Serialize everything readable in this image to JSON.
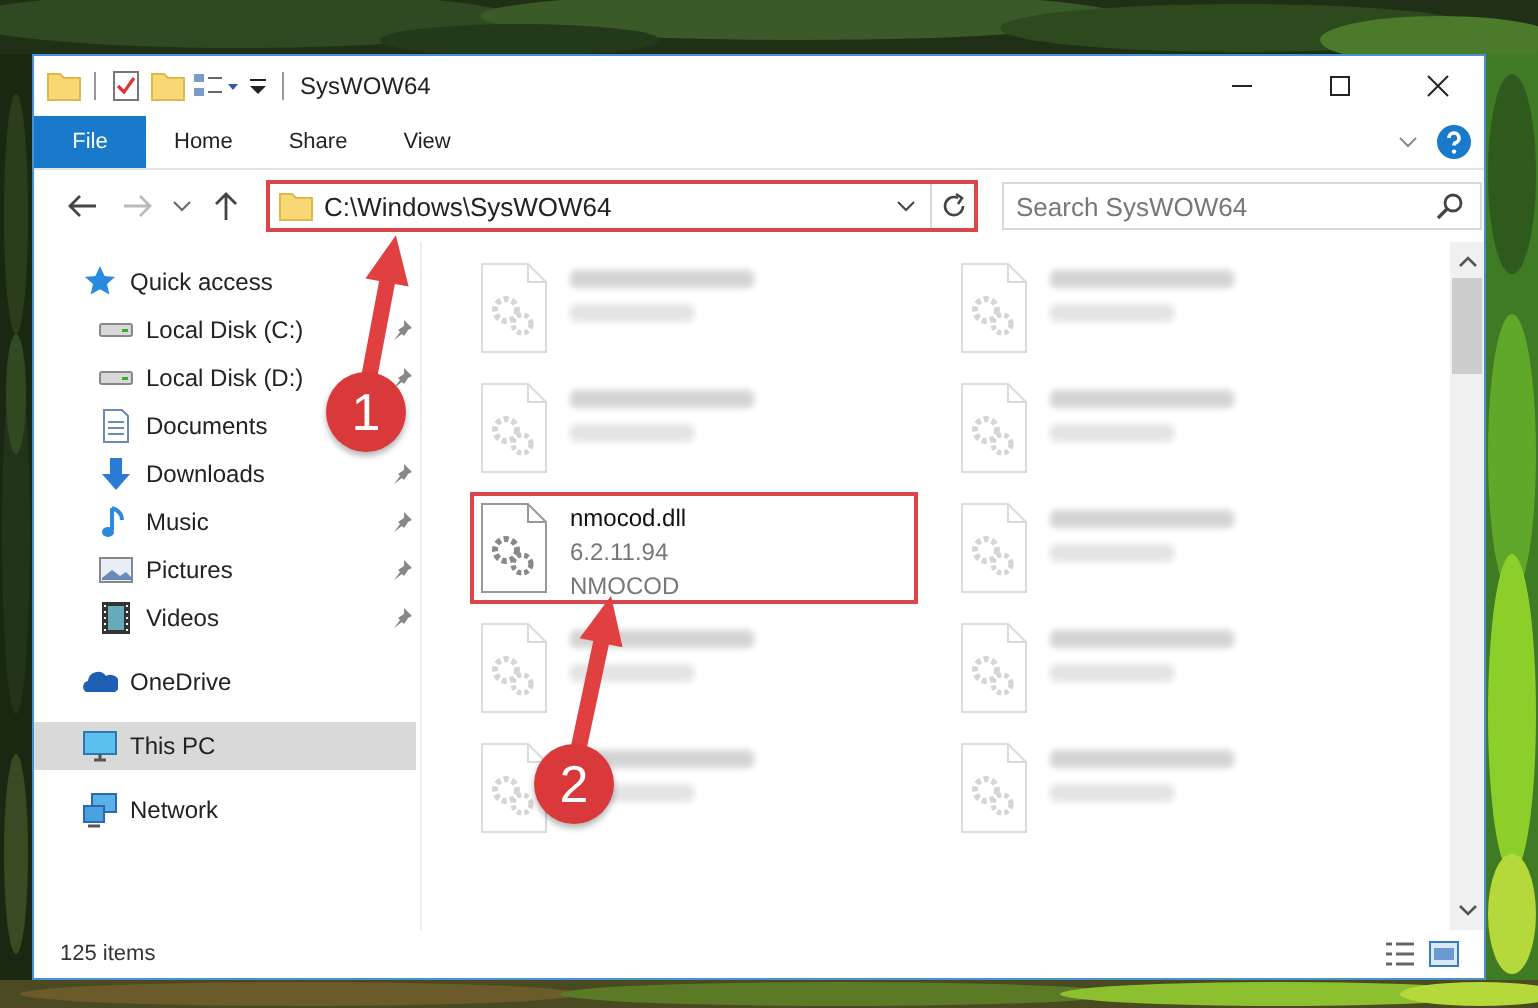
{
  "window": {
    "title": "SysWOW64"
  },
  "ribbon_tabs": [
    {
      "label": "File",
      "kind": "file"
    },
    {
      "label": "Home",
      "kind": "tab"
    },
    {
      "label": "Share",
      "kind": "tab"
    },
    {
      "label": "View",
      "kind": "tab"
    }
  ],
  "address": {
    "path": "C:\\Windows\\SysWOW64",
    "highlighted": true
  },
  "search": {
    "placeholder": "Search SysWOW64"
  },
  "sidebar": {
    "items": [
      {
        "label": "Quick access",
        "kind": "quick",
        "selected": false,
        "children": [
          {
            "label": "Local Disk (C:)",
            "kind": "drive",
            "pinned": true,
            "selected": false
          },
          {
            "label": "Local Disk (D:)",
            "kind": "drive",
            "pinned": true,
            "selected": false
          },
          {
            "label": "Documents",
            "kind": "documents",
            "selected": false
          },
          {
            "label": "Downloads",
            "kind": "downloads",
            "pinned": true,
            "selected": false
          },
          {
            "label": "Music",
            "kind": "music",
            "pinned": true,
            "selected": false
          },
          {
            "label": "Pictures",
            "kind": "pictures",
            "pinned": true,
            "selected": false
          },
          {
            "label": "Videos",
            "kind": "videos",
            "pinned": true,
            "selected": false
          }
        ]
      },
      {
        "label": "OneDrive",
        "kind": "onedrive",
        "selected": false
      },
      {
        "label": "This PC",
        "kind": "pc",
        "selected": true
      },
      {
        "label": "Network",
        "kind": "network",
        "selected": false
      }
    ]
  },
  "files": [
    {
      "kind": "blurred"
    },
    {
      "kind": "blurred"
    },
    {
      "kind": "blurred"
    },
    {
      "kind": "blurred"
    },
    {
      "kind": "file",
      "name": "nmocod.dll",
      "lines": [
        "6.2.11.94",
        "NMOCOD"
      ],
      "highlighted": true
    },
    {
      "kind": "blurred"
    },
    {
      "kind": "blurred"
    },
    {
      "kind": "blurred"
    },
    {
      "kind": "blurred"
    },
    {
      "kind": "blurred"
    }
  ],
  "status_bar": {
    "count": "125 items"
  },
  "callouts": [
    {
      "number": "1"
    },
    {
      "number": "2"
    }
  ]
}
